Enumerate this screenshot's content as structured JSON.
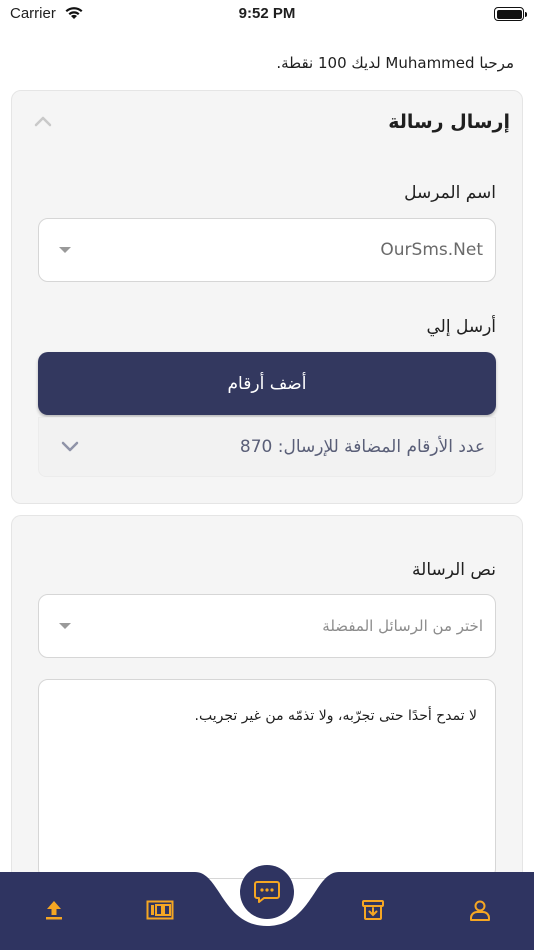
{
  "status_bar": {
    "carrier": "Carrier",
    "time": "9:52 PM",
    "battery_level": 1.0
  },
  "greeting": "مرحبا Muhammed لديك 100 نقطة.",
  "send_card": {
    "title": "إرسال رسالة",
    "sender_label": "اسم المرسل",
    "sender_value": "OurSms.Net",
    "recipients_label": "أرسل إلي",
    "add_numbers_button": "أضف أرقام",
    "added_count_text": "عدد الأرقام المضافة للإرسال: 870"
  },
  "message_card": {
    "message_label": "نص الرسالة",
    "favorites_placeholder": "اختر من الرسائل المفضلة",
    "message_text": "لا تمدح أحدًا حتى تجرّبه، ولا تذمّه من غير تجريب."
  },
  "tab_bar": {
    "items": [
      "upload-icon",
      "numbers-icon",
      "message-icon",
      "archive-icon",
      "profile-icon"
    ],
    "active": "message-icon"
  },
  "colors": {
    "primary": "#33385f",
    "accent": "#f5a623",
    "card_bg": "#f5f5f5"
  }
}
